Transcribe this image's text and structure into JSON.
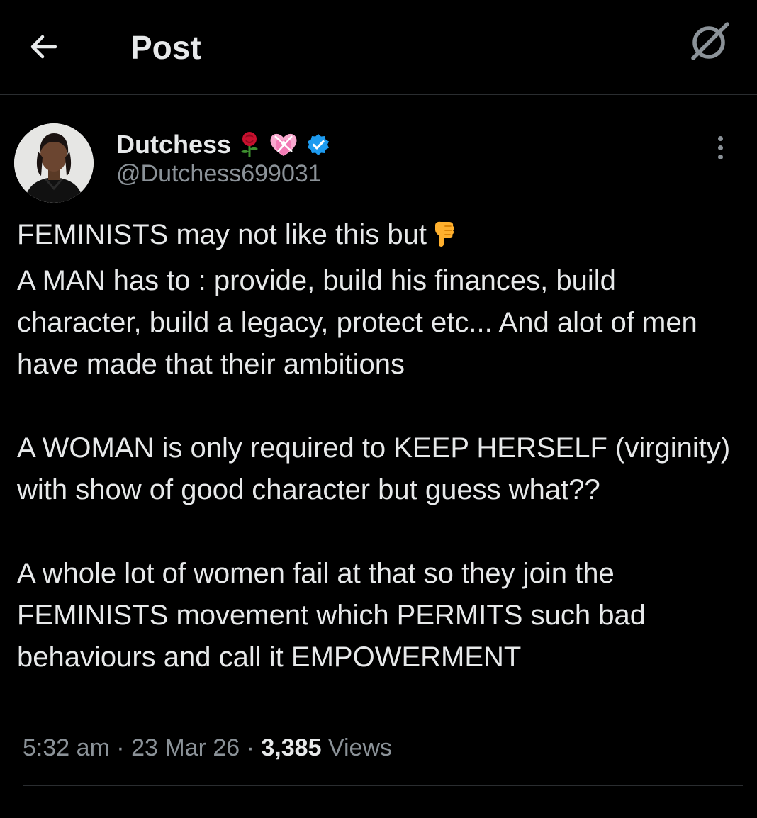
{
  "header": {
    "title": "Post",
    "back_icon": "arrow-left-icon",
    "grok_icon": "grok-icon"
  },
  "author": {
    "display_name": "Dutchess",
    "emojis": [
      "rose-emoji",
      "heart-with-ribbon-emoji"
    ],
    "verified": true,
    "handle": "@Dutchess699031",
    "more_icon": "more-vertical-icon"
  },
  "tweet": {
    "paragraphs": [
      {
        "lines": [
          "FEMINISTS may not like this but",
          "A MAN has to : provide, build his finances, build character, build a legacy, protect etc... And alot of men have made that their ambitions"
        ]
      },
      {
        "lines": [
          "A WOMAN is only required to KEEP HERSELF (virginity) with show of good character but guess what??"
        ]
      },
      {
        "lines": [
          "A whole lot of women fail at that so they join the FEMINISTS movement which PERMITS such bad behaviours and call it EMPOWERMENT"
        ]
      }
    ],
    "first_line_emoji": "backhand-index-pointing-down-emoji"
  },
  "meta": {
    "time": "5:32 am",
    "separator": " · ",
    "date": "23 Mar 26",
    "views_count": "3,385",
    "views_label": " Views"
  },
  "colors": {
    "background": "#000000",
    "text_primary": "#e7e9ea",
    "text_secondary": "#8b9298",
    "verified_blue": "#1d9bf0",
    "divider": "#2a2d30"
  }
}
